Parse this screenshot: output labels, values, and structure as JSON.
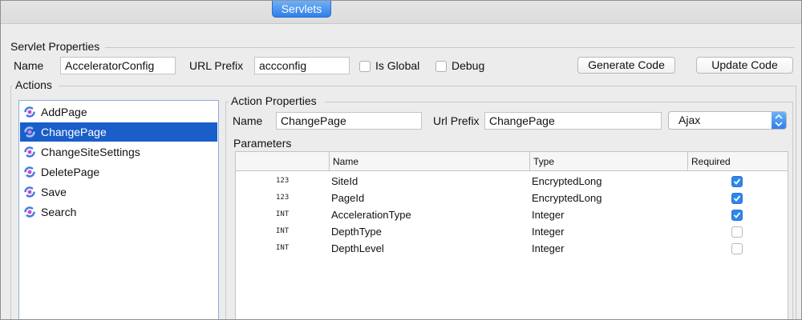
{
  "tab": {
    "label": "Servlets"
  },
  "servlet_properties": {
    "title": "Servlet Properties",
    "name_label": "Name",
    "name_value": "AcceleratorConfig",
    "url_prefix_label": "URL Prefix",
    "url_prefix_value": "accconfig",
    "is_global_label": "Is Global",
    "debug_label": "Debug",
    "generate_code_label": "Generate Code",
    "update_code_label": "Update Code"
  },
  "actions": {
    "title": "Actions",
    "items": [
      {
        "label": "AddPage",
        "selected": false,
        "icon": "sync-icon"
      },
      {
        "label": "ChangePage",
        "selected": true,
        "icon": "sync-icon"
      },
      {
        "label": "ChangeSiteSettings",
        "selected": false,
        "icon": "sync-icon"
      },
      {
        "label": "DeletePage",
        "selected": false,
        "icon": "sync-icon"
      },
      {
        "label": "Save",
        "selected": false,
        "icon": "sync-icon"
      },
      {
        "label": "Search",
        "selected": false,
        "icon": "sync-icon"
      }
    ]
  },
  "action_properties": {
    "title": "Action Properties",
    "name_label": "Name",
    "name_value": "ChangePage",
    "url_prefix_label": "Url Prefix",
    "url_prefix_value": "ChangePage",
    "method_value": "Ajax"
  },
  "parameters": {
    "title": "Parameters",
    "columns": [
      "",
      "Name",
      "Type",
      "Required"
    ],
    "rows": [
      {
        "tag": "123",
        "name": "SiteId",
        "type": "EncryptedLong",
        "required": true
      },
      {
        "tag": "123",
        "name": "PageId",
        "type": "EncryptedLong",
        "required": true
      },
      {
        "tag": "INT",
        "name": "AccelerationType",
        "type": "Integer",
        "required": true
      },
      {
        "tag": "INT",
        "name": "DepthType",
        "type": "Integer",
        "required": false
      },
      {
        "tag": "INT",
        "name": "DepthLevel",
        "type": "Integer",
        "required": false
      }
    ]
  },
  "colors": {
    "selection": "#1a5ec9",
    "accent": "#2f86ec"
  }
}
